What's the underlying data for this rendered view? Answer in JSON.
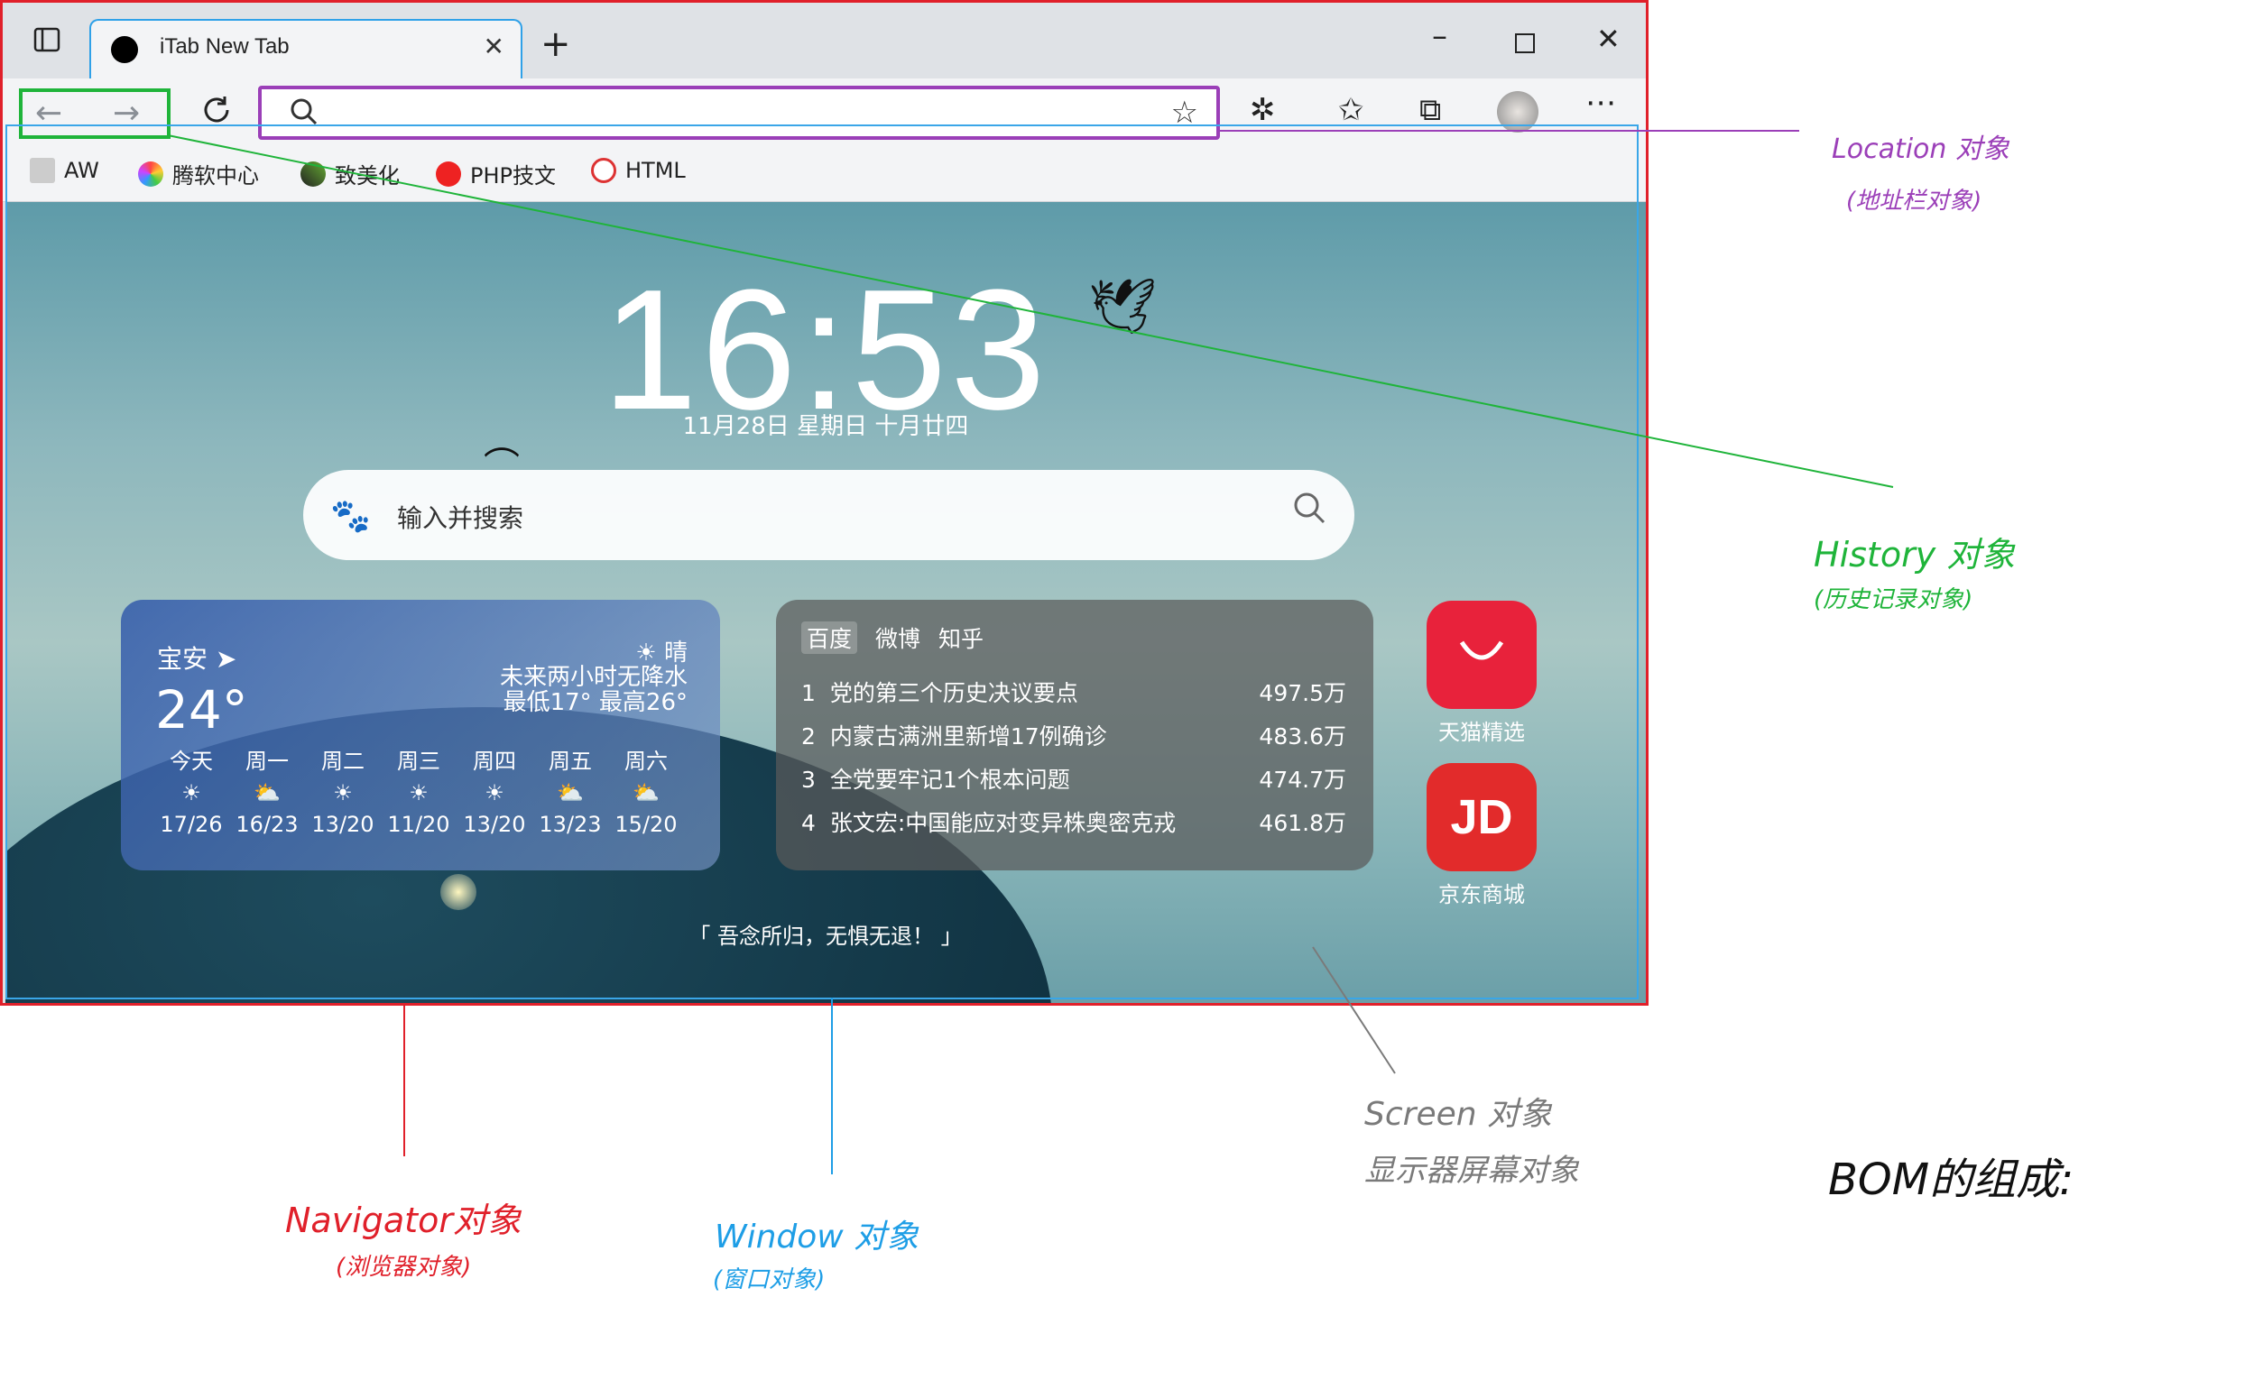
{
  "tab": {
    "title": "iTab New Tab"
  },
  "bookmarks": [
    {
      "label": "AW"
    },
    {
      "label": "腾软中心"
    },
    {
      "label": "致美化"
    },
    {
      "label": "PHP技文"
    },
    {
      "label": "HTML"
    }
  ],
  "newtab": {
    "clock": "16:53",
    "date": "11月28日 星期日 十月廿四",
    "search_placeholder": "输入并搜索",
    "weather": {
      "city": "宝安",
      "temp": "24°",
      "condition": "晴",
      "forecast_text": "未来两小时无降水",
      "range": "最低17° 最高26°",
      "days": [
        {
          "day": "今天",
          "temp": "17/26"
        },
        {
          "day": "周一",
          "temp": "16/23"
        },
        {
          "day": "周二",
          "temp": "13/20"
        },
        {
          "day": "周三",
          "temp": "11/20"
        },
        {
          "day": "周四",
          "temp": "13/20"
        },
        {
          "day": "周五",
          "temp": "13/23"
        },
        {
          "day": "周六",
          "temp": "15/20"
        }
      ]
    },
    "hot": {
      "tabs": [
        "百度",
        "微博",
        "知乎"
      ],
      "items": [
        {
          "rank": "1",
          "title": "党的第三个历史决议要点",
          "count": "497.5万"
        },
        {
          "rank": "2",
          "title": "内蒙古满洲里新增17例确诊",
          "count": "483.6万"
        },
        {
          "rank": "3",
          "title": "全党要牢记1个根本问题",
          "count": "474.7万"
        },
        {
          "rank": "4",
          "title": "张文宏:中国能应对变异株奥密克戎",
          "count": "461.8万"
        }
      ]
    },
    "apps": [
      {
        "label": "天猫精选",
        "icon_text": ""
      },
      {
        "label": "京东商城",
        "icon_text": "JD"
      }
    ],
    "quote": "「 吾念所归，无惧无退！ 」"
  },
  "annotations": {
    "location": {
      "title": "Location 对象",
      "sub": "(地址栏对象)",
      "color": "#9b3fb8"
    },
    "history": {
      "title": "History 对象",
      "sub": "(历史记录对象)",
      "color": "#1fb43a"
    },
    "screen": {
      "title": "Screen 对象",
      "sub": "显示器屏幕对象",
      "color": "#7a7a7a"
    },
    "navigator": {
      "title": "Navigator对象",
      "sub": "(浏览器对象)",
      "color": "#e0202a"
    },
    "window": {
      "title": "Window 对象",
      "sub": "(窗口对象)",
      "color": "#1e9ee6"
    },
    "bom": {
      "title": "BOM的组成:"
    }
  }
}
